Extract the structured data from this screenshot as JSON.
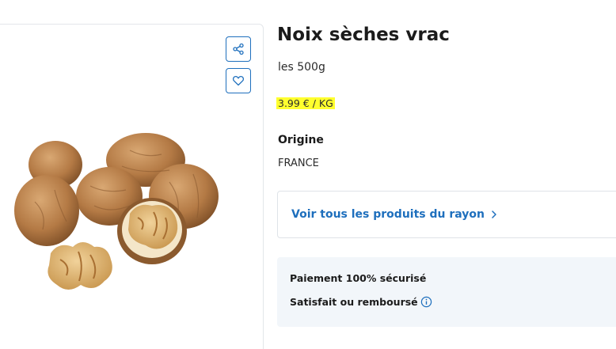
{
  "product": {
    "title": "Noix sèches vrac",
    "weight": "les 500g",
    "unit_price": "3.99 € / KG",
    "origin_label": "Origine",
    "origin_value": "FRANCE"
  },
  "actions": {
    "share_icon": "share-icon",
    "favorite_icon": "heart-icon"
  },
  "links": {
    "rayon": "Voir tous les produits du rayon"
  },
  "trust": {
    "secure_payment": "Paiement 100% sécurisé",
    "refund": "Satisfait ou remboursé"
  },
  "colors": {
    "accent": "#1e6fbd",
    "highlight": "#ffff2e",
    "trust_bg": "#f2f6fa"
  }
}
